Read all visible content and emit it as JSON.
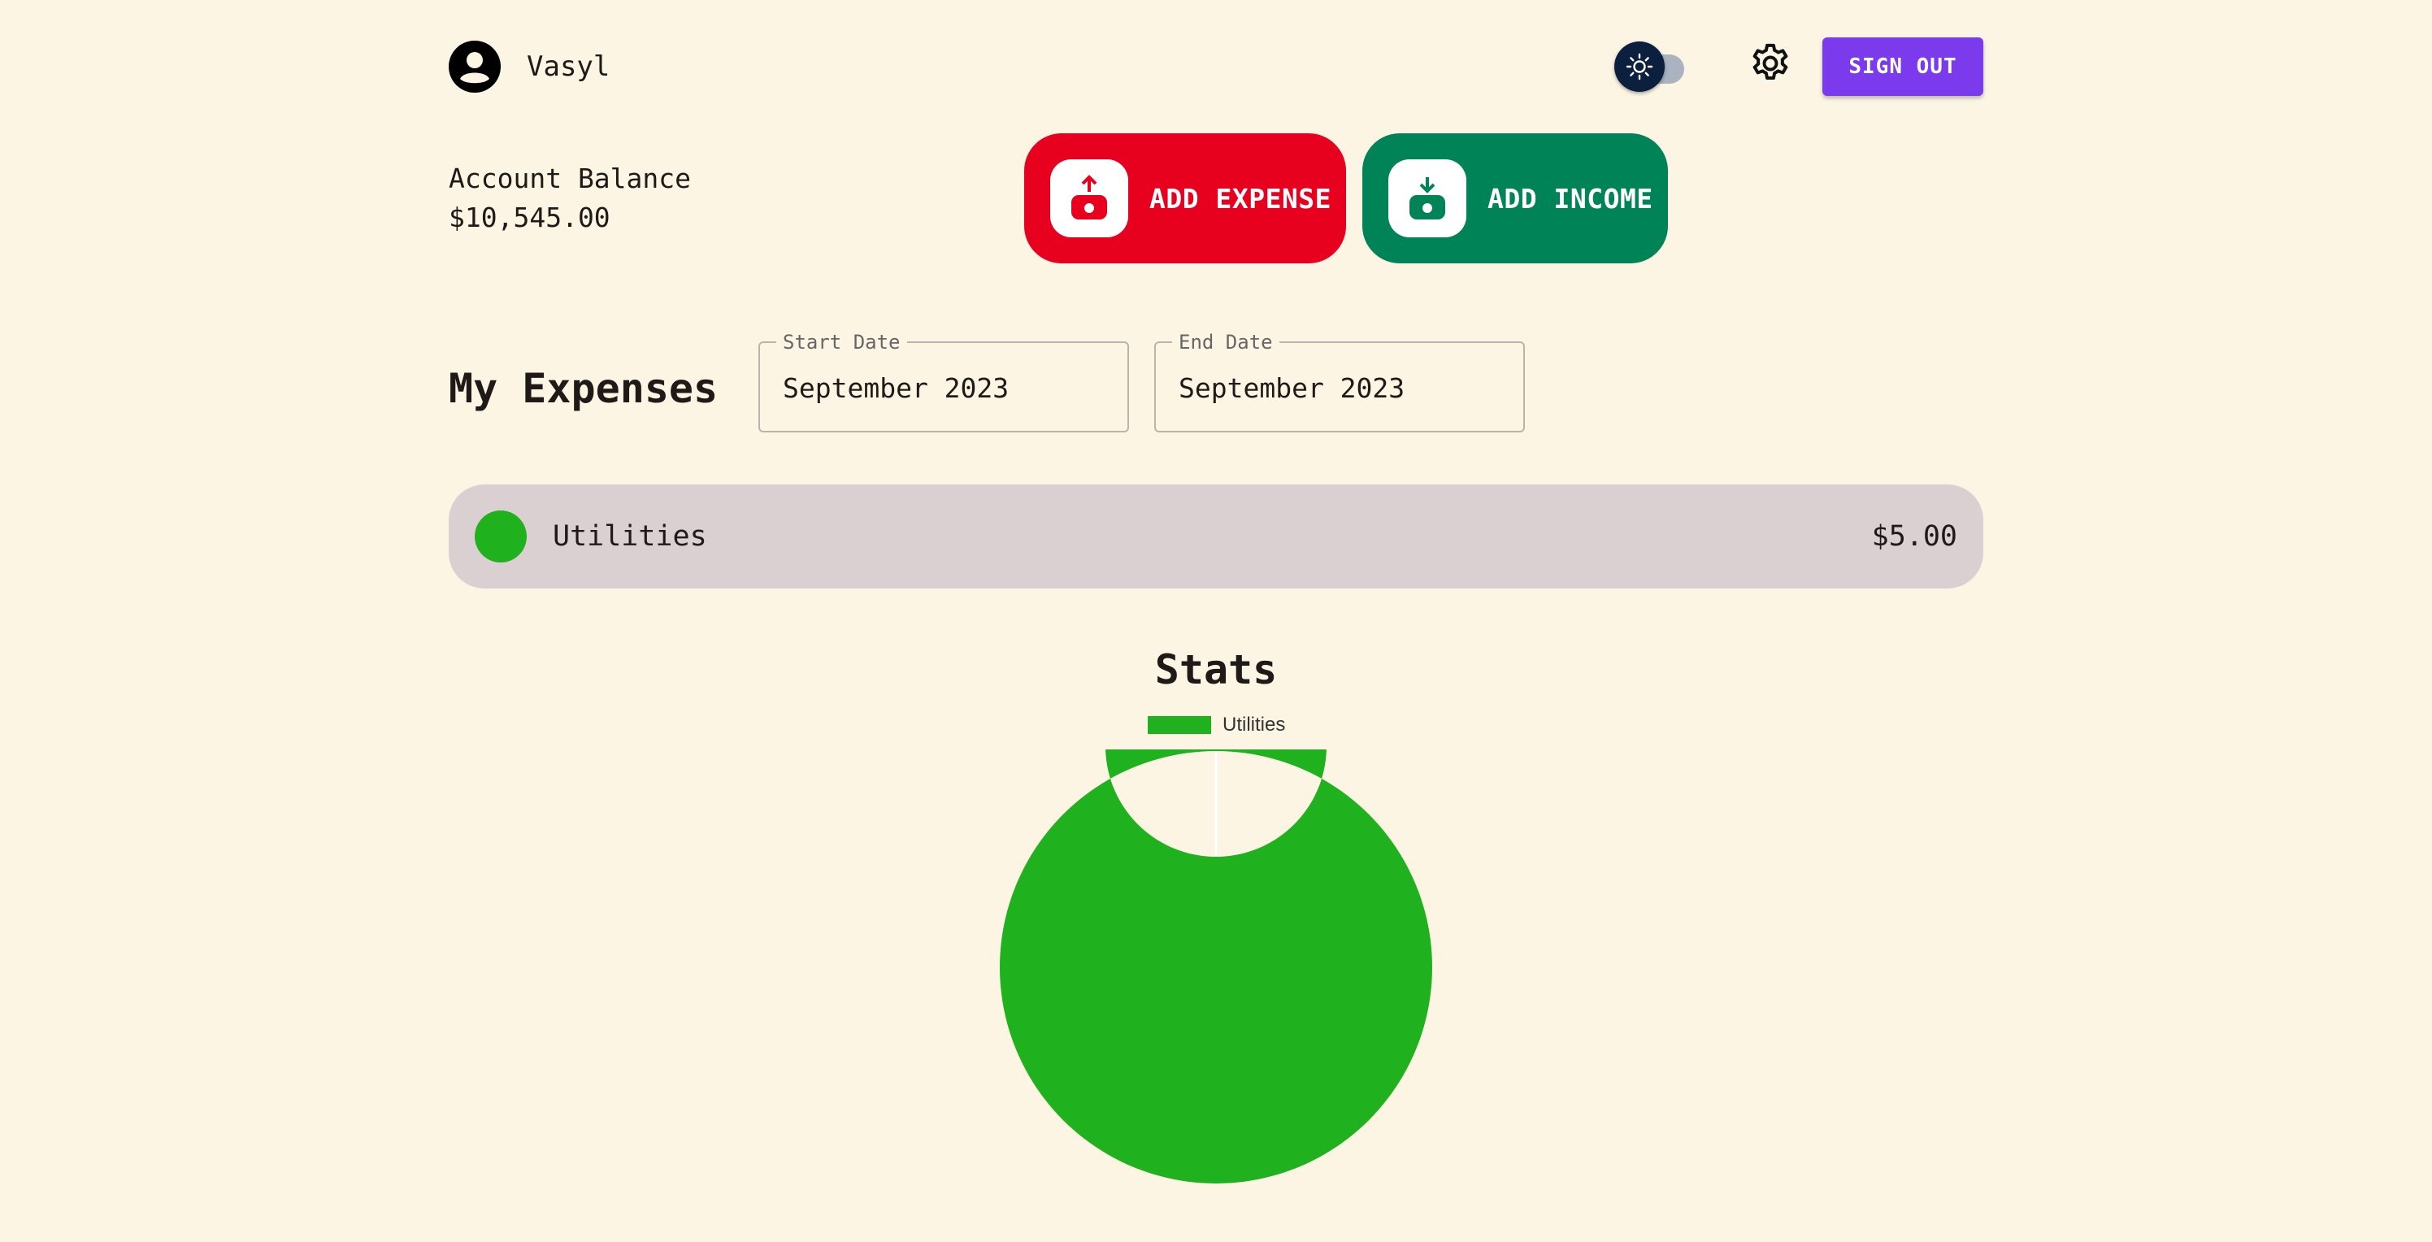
{
  "header": {
    "user_name": "Vasyl",
    "sign_out_label": "SIGN OUT"
  },
  "balance": {
    "label": "Account Balance",
    "value": "$10,545.00"
  },
  "actions": {
    "add_expense_label": "ADD EXPENSE",
    "add_income_label": "ADD INCOME",
    "expense_color": "#e8001f",
    "income_color": "#008356"
  },
  "expenses": {
    "title": "My Expenses",
    "start_date": {
      "label": "Start Date",
      "value": "September 2023"
    },
    "end_date": {
      "label": "End Date",
      "value": "September 2023"
    },
    "items": [
      {
        "name": "Utilities",
        "amount": "$5.00",
        "color": "#20b11e"
      }
    ]
  },
  "stats": {
    "title": "Stats"
  },
  "chart_data": {
    "type": "pie",
    "donut": true,
    "categories": [
      "Utilities"
    ],
    "values": [
      5
    ],
    "colors": [
      "#20b11e"
    ],
    "legend": "top"
  }
}
